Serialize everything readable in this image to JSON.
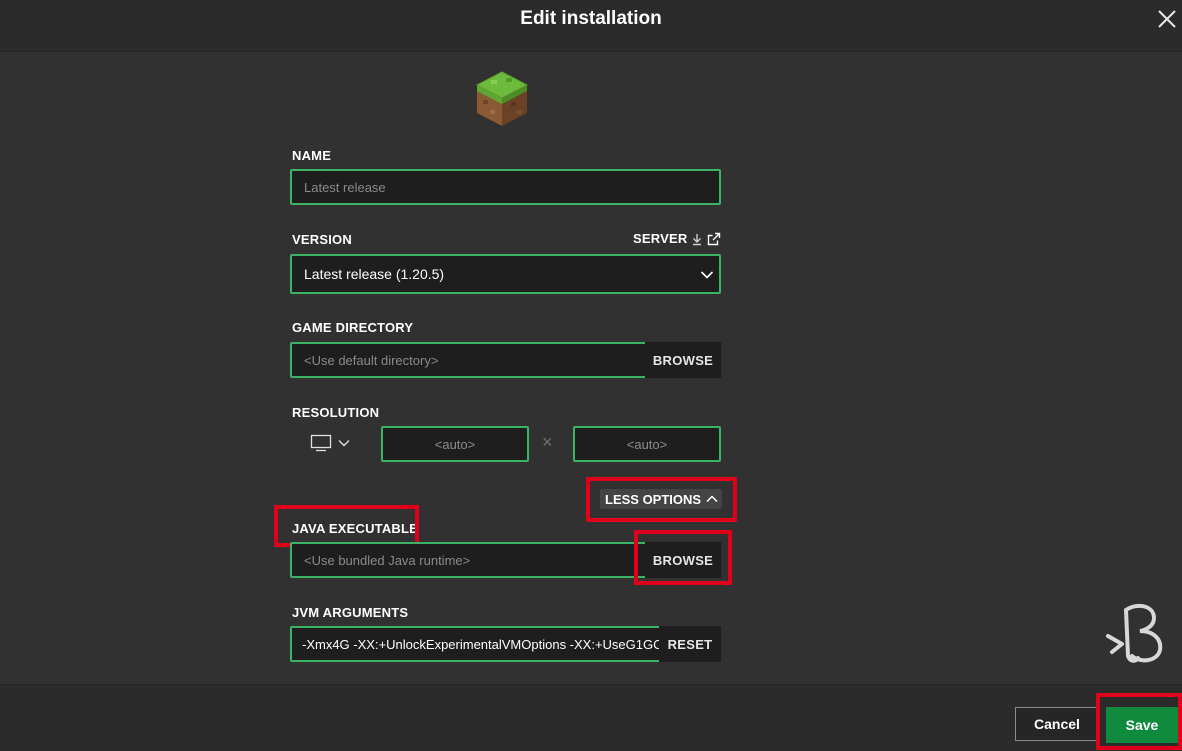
{
  "header": {
    "title": "Edit installation"
  },
  "form": {
    "name_label": "NAME",
    "name_placeholder": "Latest release",
    "version_label": "VERSION",
    "server_label": "SERVER",
    "version_value": "Latest release (1.20.5)",
    "game_directory_label": "GAME DIRECTORY",
    "game_directory_placeholder": "<Use default directory>",
    "browse_label": "BROWSE",
    "resolution_label": "RESOLUTION",
    "resolution_width": "<auto>",
    "resolution_height": "<auto>",
    "resolution_separator": "×",
    "less_options_label": "LESS OPTIONS",
    "java_executable_label": "JAVA EXECUTABLE",
    "java_executable_placeholder": "<Use bundled Java runtime>",
    "java_browse_label": "BROWSE",
    "jvm_arguments_label": "JVM ARGUMENTS",
    "jvm_arguments_value": "-Xmx4G -XX:+UnlockExperimentalVMOptions -XX:+UseG1GC",
    "reset_label": "RESET"
  },
  "footer": {
    "cancel_label": "Cancel",
    "save_label": "Save"
  },
  "colors": {
    "accent_green": "#3bb364",
    "save_green": "#108a3c",
    "highlight_red": "#e0001b",
    "background": "#313131"
  },
  "icons": [
    "close-icon",
    "grass-block-icon",
    "download-icon",
    "external-link-icon",
    "chevron-down-icon",
    "monitor-icon",
    "chevron-up-icon",
    "watermark-logo-icon"
  ]
}
